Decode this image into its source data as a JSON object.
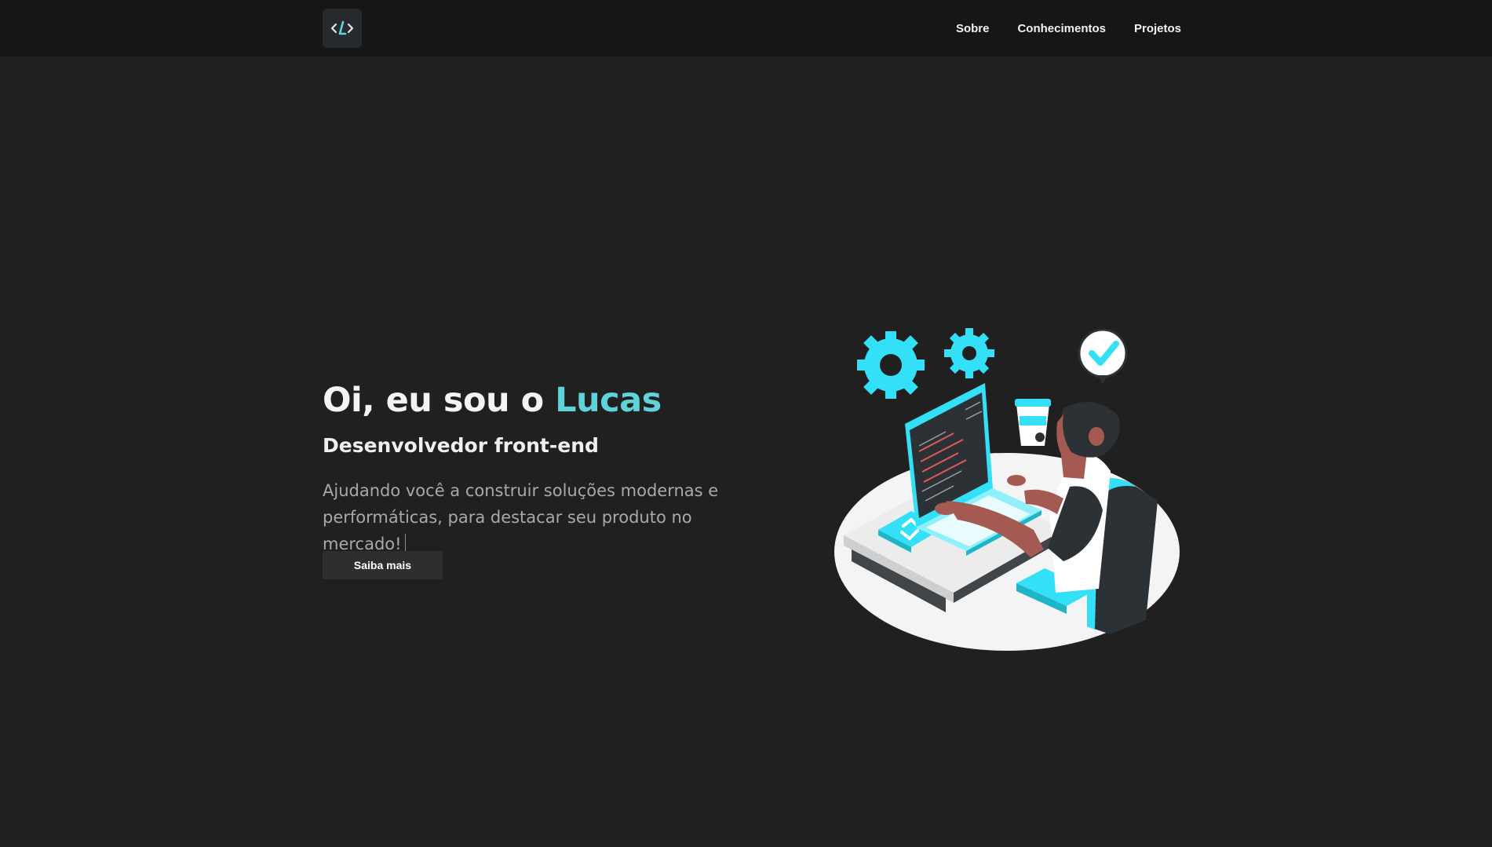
{
  "header": {
    "logo_icon": "code-slash-icon",
    "nav": [
      {
        "label": "Sobre"
      },
      {
        "label": "Conhecimentos"
      },
      {
        "label": "Projetos"
      }
    ]
  },
  "hero": {
    "greeting": "Oi, eu sou o ",
    "name": "Lucas",
    "role": "Desenvolvedor front-end",
    "tagline": "Ajudando você a construir soluções modernas e performáticas, para destacar seu produto no mercado!",
    "cta_label": "Saiba mais"
  },
  "illustration": {
    "icon": "developer-at-laptop-illustration",
    "accent_color": "#33e0f7"
  },
  "colors": {
    "background": "#202020",
    "navbar": "#161616",
    "accent": "#5fd3da"
  }
}
